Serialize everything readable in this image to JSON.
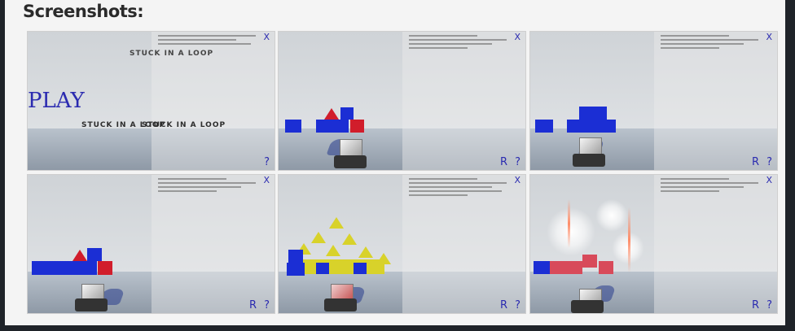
{
  "page": {
    "heading": "Screenshots:"
  },
  "shots": [
    {
      "overlay": {
        "close": "X",
        "help": "?"
      },
      "play_label": "PLAY",
      "text_top": "STUCK IN A LOOP",
      "text_bottom": "STUCK IN A LOOP"
    },
    {
      "overlay": {
        "close": "X",
        "reset": "R",
        "help": "?"
      }
    },
    {
      "overlay": {
        "close": "X",
        "reset": "R",
        "help": "?"
      }
    },
    {
      "overlay": {
        "close": "X",
        "reset": "R",
        "help": "?"
      }
    },
    {
      "overlay": {
        "close": "X",
        "reset": "R",
        "help": "?"
      }
    },
    {
      "overlay": {
        "close": "X",
        "reset": "R",
        "help": "?"
      }
    }
  ],
  "colors": {
    "accent_blue": "#2b2bb0",
    "cube_blue": "#1b2ed4",
    "cube_red": "#d11d2b",
    "pyramid_yellow": "#d8d22a"
  }
}
